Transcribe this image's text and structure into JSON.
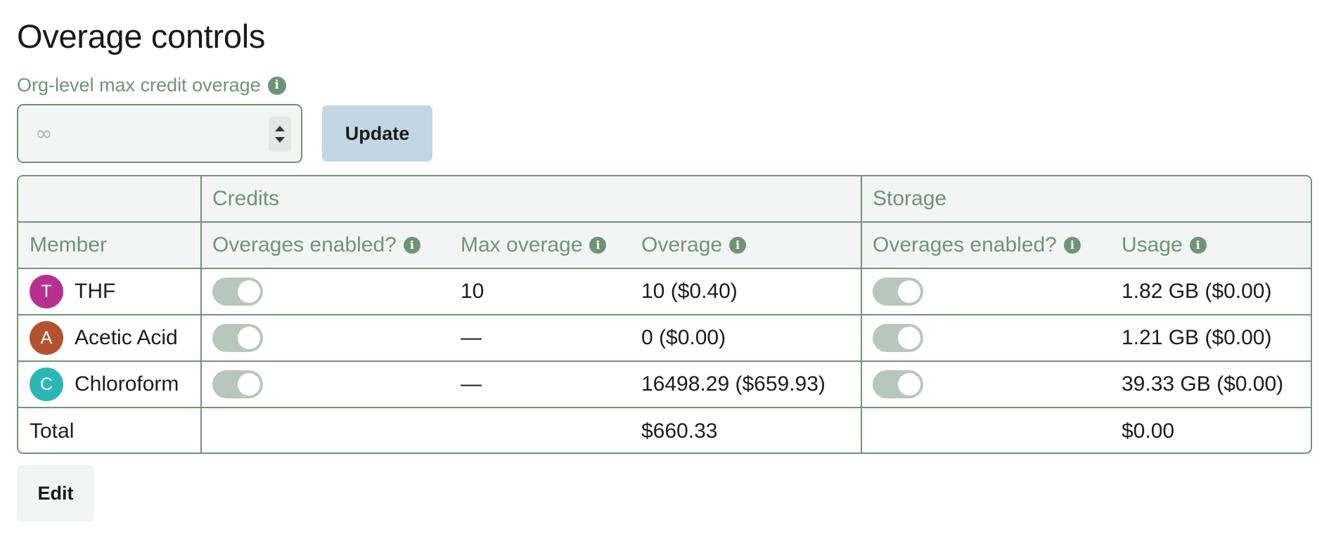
{
  "page": {
    "title": "Overage controls"
  },
  "org_limit": {
    "label": "Org-level max credit overage",
    "placeholder": "∞",
    "update_label": "Update"
  },
  "table": {
    "group_headers": {
      "credits": "Credits",
      "storage": "Storage"
    },
    "columns": {
      "member": "Member",
      "credits_overages_enabled": "Overages enabled?",
      "max_overage": "Max overage",
      "overage": "Overage",
      "storage_overages_enabled": "Overages enabled?",
      "usage": "Usage"
    },
    "rows": [
      {
        "initial": "T",
        "avatar_color": "#b8308f",
        "name": "THF",
        "credits_overages_enabled": true,
        "max_overage": "10",
        "overage": "10 ($0.40)",
        "storage_overages_enabled": true,
        "usage": "1.82 GB ($0.00)"
      },
      {
        "initial": "A",
        "avatar_color": "#b5522e",
        "name": "Acetic Acid",
        "credits_overages_enabled": true,
        "max_overage": "—",
        "overage": "0 ($0.00)",
        "storage_overages_enabled": true,
        "usage": "1.21 GB ($0.00)"
      },
      {
        "initial": "C",
        "avatar_color": "#2bb6b6",
        "name": "Chloroform",
        "credits_overages_enabled": true,
        "max_overage": "—",
        "overage": "16498.29 ($659.93)",
        "storage_overages_enabled": true,
        "usage": "39.33 GB ($0.00)"
      }
    ],
    "total": {
      "label": "Total",
      "credits": "$660.33",
      "storage": "$0.00"
    }
  },
  "actions": {
    "edit_label": "Edit"
  },
  "colors": {
    "accent": "#6e9478",
    "toggle_track": "#b7c7bb",
    "update_button": "#c4d6e3"
  }
}
